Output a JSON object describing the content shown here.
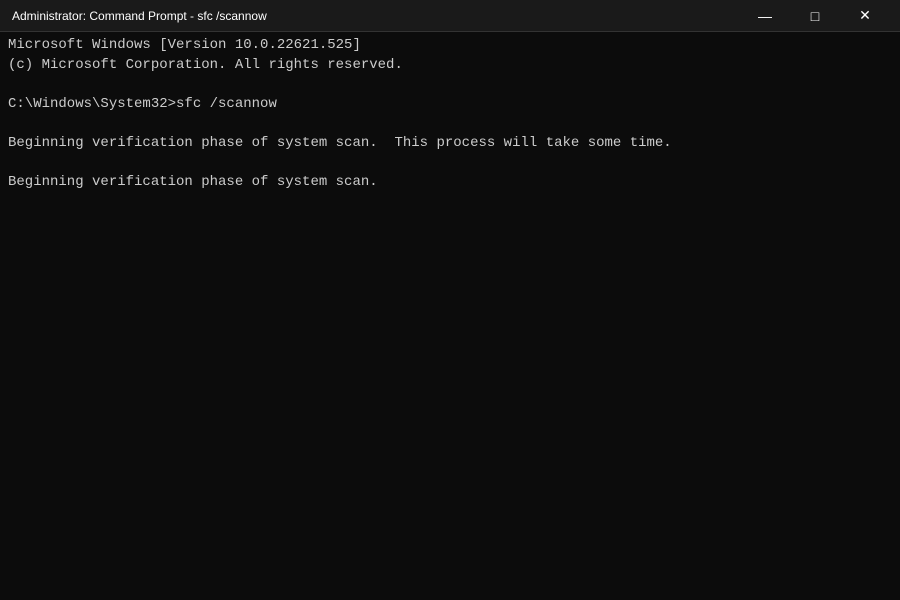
{
  "titlebar": {
    "text": "Administrator: Command Prompt - sfc /scannow",
    "minimize_label": "—",
    "maximize_label": "□",
    "close_label": "✕"
  },
  "terminal": {
    "lines": [
      "Microsoft Windows [Version 10.0.22621.525]",
      "(c) Microsoft Corporation. All rights reserved.",
      "",
      "C:\\Windows\\System32>sfc /scannow",
      "",
      "Beginning verification phase of system scan.  This process will take some time.",
      "",
      "Beginning verification phase of system scan.",
      "",
      "",
      "",
      "",
      "",
      "",
      "",
      "",
      "",
      "",
      "",
      "",
      "",
      "",
      "",
      ""
    ]
  }
}
